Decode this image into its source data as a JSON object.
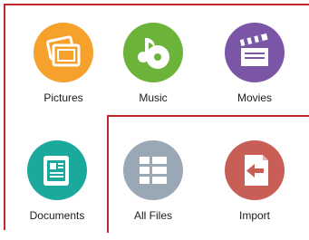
{
  "apps": [
    {
      "label": "Pictures",
      "icon": "pictures-icon",
      "color": "#f5a12b"
    },
    {
      "label": "Music",
      "icon": "music-icon",
      "color": "#6cb33a"
    },
    {
      "label": "Movies",
      "icon": "movies-icon",
      "color": "#7b55a6"
    },
    {
      "label": "Documents",
      "icon": "documents-icon",
      "color": "#1ba99d"
    },
    {
      "label": "All Files",
      "icon": "all-files-icon",
      "color": "#9aa8b6"
    },
    {
      "label": "Import",
      "icon": "import-icon",
      "color": "#c85e55"
    }
  ],
  "frame_color": "#c0282e"
}
